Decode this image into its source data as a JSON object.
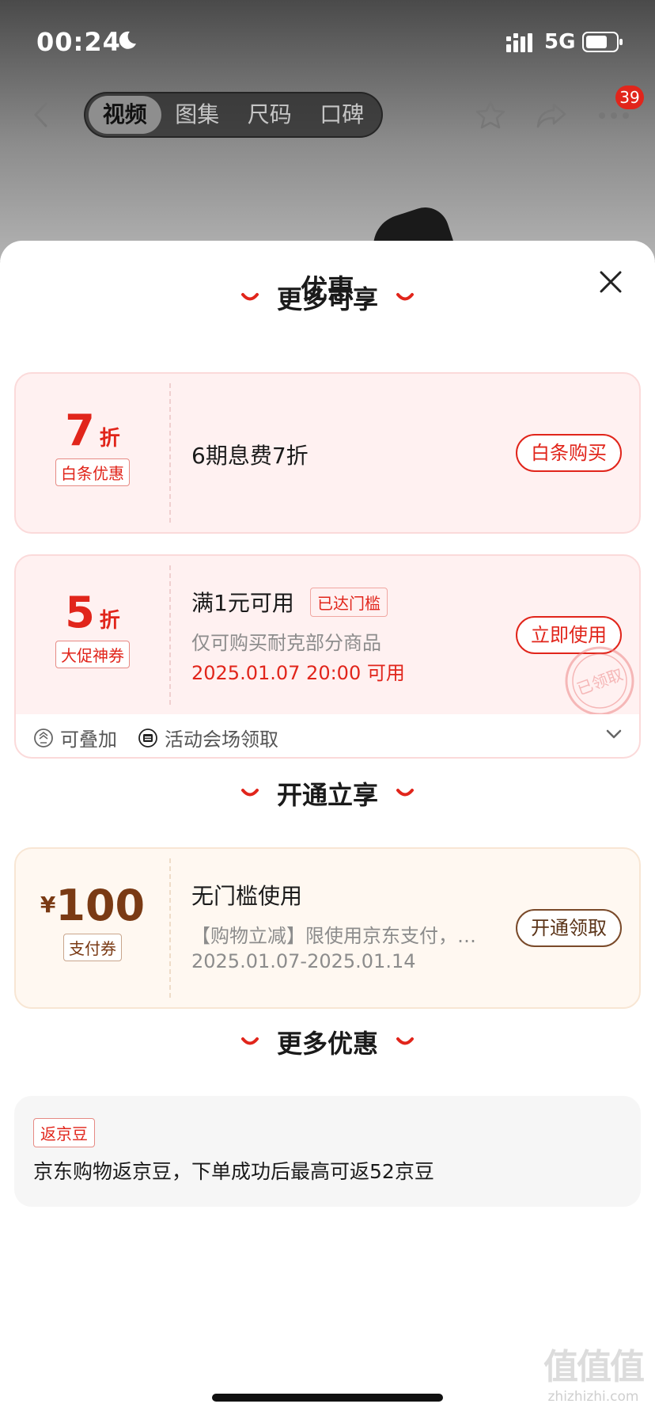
{
  "status_bar": {
    "time": "00:24",
    "network": "5G"
  },
  "nav": {
    "tabs": [
      "视频",
      "图集",
      "尺码",
      "口碑"
    ],
    "active_tab": 0,
    "badge_count": "39"
  },
  "sheet": {
    "title": "优惠"
  },
  "sections": {
    "more_enjoy": "更多可享",
    "activate_enjoy": "开通立享",
    "more_offers": "更多优惠"
  },
  "baitiao_card": {
    "value": "7",
    "unit": "折",
    "tag": "白条优惠",
    "title": "6期息费7折",
    "button": "白条购买"
  },
  "promo_card": {
    "value": "5",
    "unit": "折",
    "tag": "大促神券",
    "title": "满1元可用",
    "threshold_tag": "已达门槛",
    "desc": "仅可购买耐克部分商品",
    "time": "2025.01.07 20:00 可用",
    "button": "立即使用",
    "stamp": "已领取",
    "foot_stackable": "可叠加",
    "foot_source": "活动会场领取"
  },
  "pay_card": {
    "currency": "¥",
    "amount": "100",
    "tag": "支付券",
    "title": "无门槛使用",
    "desc": "【购物立减】限使用京东支付，…",
    "period": "2025.01.07-2025.01.14",
    "button": "开通领取"
  },
  "bean_card": {
    "tag": "返京豆",
    "text": "京东购物返京豆，下单成功后最高可返52京豆"
  },
  "watermark": {
    "logo": "值值值",
    "site": "zhizhizhi.com"
  },
  "colors": {
    "accent_red": "#e1251b",
    "brown": "#7a3a14",
    "card_pink": "#fff1f1",
    "card_cream": "#fff8f1"
  }
}
